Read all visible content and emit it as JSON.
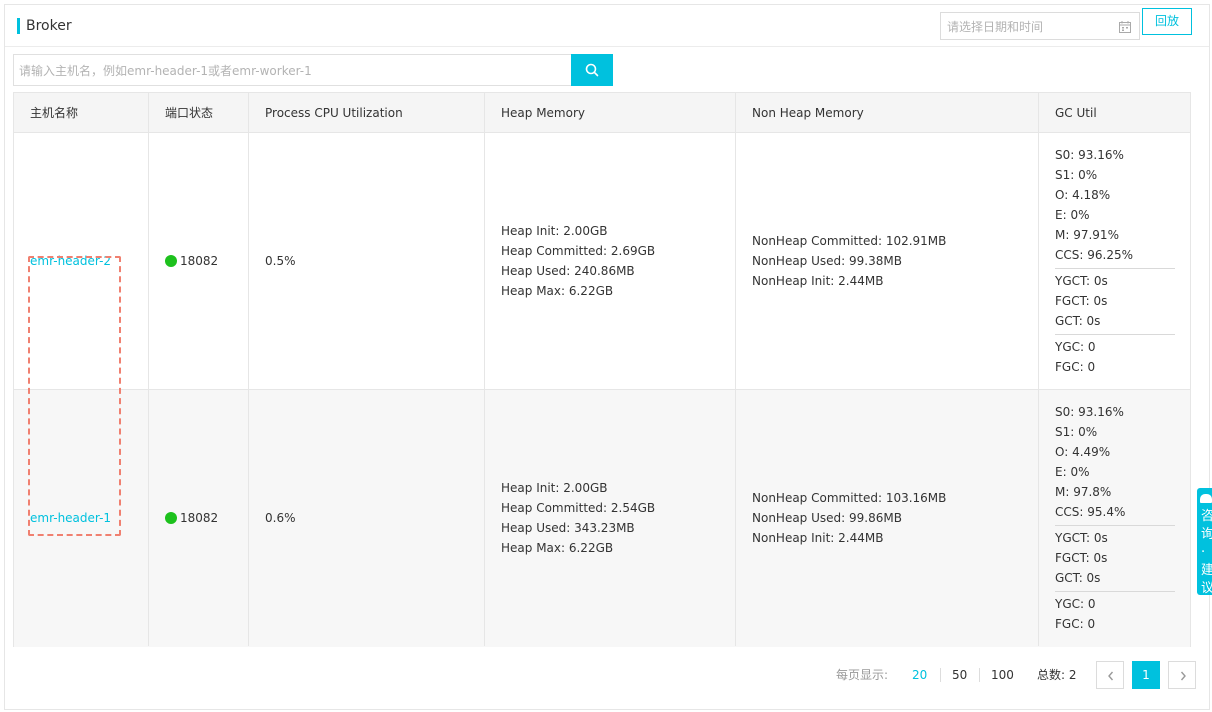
{
  "header": {
    "title": "Broker",
    "date_placeholder": "请选择日期和时间",
    "replay_label": "回放"
  },
  "search": {
    "placeholder": "请输入主机名，例如emr-header-1或者emr-worker-1"
  },
  "table": {
    "columns": [
      "主机名称",
      "端口状态",
      "Process CPU Utilization",
      "Heap Memory",
      "Non Heap Memory",
      "GC Util"
    ],
    "rows": [
      {
        "host": "emr-header-2",
        "port": "18082",
        "cpu": "0.5%",
        "heap": [
          "Heap Init: 2.00GB",
          "Heap Committed: 2.69GB",
          "Heap Used: 240.86MB",
          "Heap Max: 6.22GB"
        ],
        "nonheap": [
          "NonHeap Committed: 102.91MB",
          "NonHeap Used: 99.38MB",
          "NonHeap Init: 2.44MB"
        ],
        "gc1": [
          "S0: 93.16%",
          "S1: 0%",
          "O: 4.18%",
          "E: 0%",
          "M: 97.91%",
          "CCS: 96.25%"
        ],
        "gc2": [
          "YGCT: 0s",
          "FGCT: 0s",
          "GCT: 0s"
        ],
        "gc3": [
          "YGC: 0",
          "FGC: 0"
        ]
      },
      {
        "host": "emr-header-1",
        "port": "18082",
        "cpu": "0.6%",
        "heap": [
          "Heap Init: 2.00GB",
          "Heap Committed: 2.54GB",
          "Heap Used: 343.23MB",
          "Heap Max: 6.22GB"
        ],
        "nonheap": [
          "NonHeap Committed: 103.16MB",
          "NonHeap Used: 99.86MB",
          "NonHeap Init: 2.44MB"
        ],
        "gc1": [
          "S0: 93.16%",
          "S1: 0%",
          "O: 4.49%",
          "E: 0%",
          "M: 97.8%",
          "CCS: 95.4%"
        ],
        "gc2": [
          "YGCT: 0s",
          "FGCT: 0s",
          "GCT: 0s"
        ],
        "gc3": [
          "YGC: 0",
          "FGC: 0"
        ]
      }
    ]
  },
  "pagination": {
    "per_page_label": "每页显示:",
    "sizes": [
      "20",
      "50",
      "100"
    ],
    "active_size": "20",
    "total_label": "总数: 2",
    "current_page": "1"
  },
  "feedback": {
    "label": "咨询·建议"
  },
  "colors": {
    "accent": "#00c1de",
    "status_ok": "#1dc11d",
    "highlight": "#f08070"
  }
}
